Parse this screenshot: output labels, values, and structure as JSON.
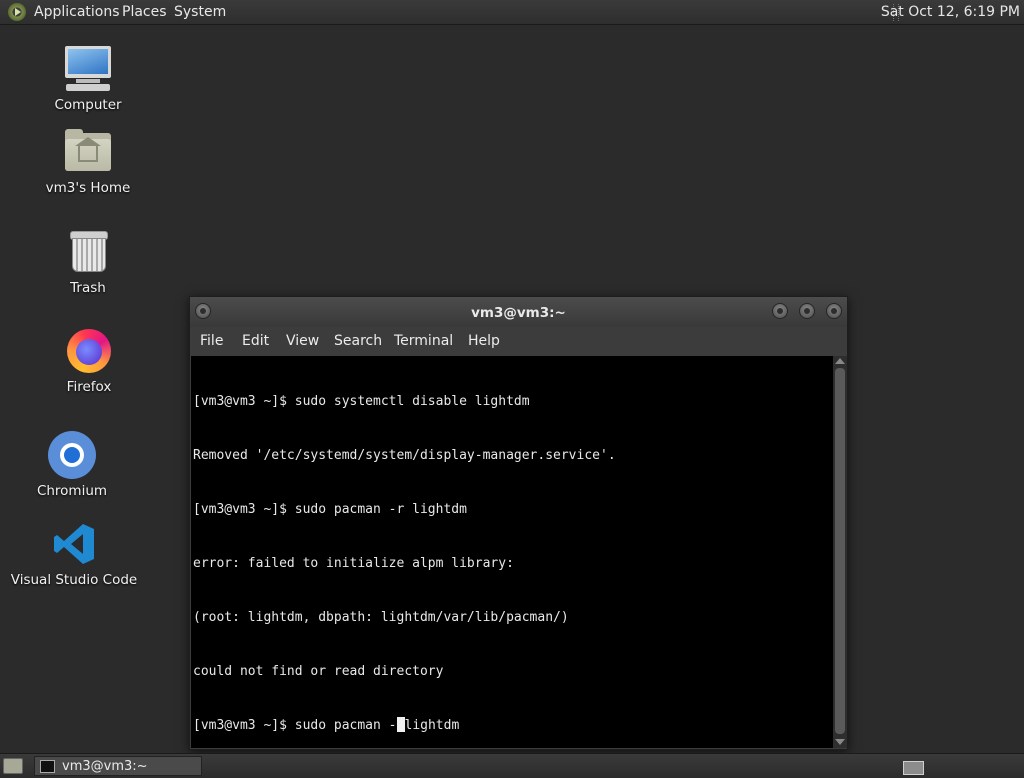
{
  "top_panel": {
    "menus": [
      "Applications",
      "Places",
      "System"
    ],
    "clock": "Sat Oct 12,  6:19 PM"
  },
  "desktop": {
    "icons": [
      {
        "label": "Computer",
        "icon": "computer-icon"
      },
      {
        "label": "vm3's Home",
        "icon": "home-folder-icon"
      },
      {
        "label": "Trash",
        "icon": "trash-icon"
      },
      {
        "label": "Firefox",
        "icon": "firefox-icon"
      },
      {
        "label": "Chromium",
        "icon": "chromium-icon"
      },
      {
        "label": "Visual Studio Code",
        "icon": "vscode-icon"
      }
    ]
  },
  "terminal": {
    "title": "vm3@vm3:~",
    "menu": [
      "File",
      "Edit",
      "View",
      "Search",
      "Terminal",
      "Help"
    ],
    "lines": [
      "[vm3@vm3 ~]$ sudo systemctl disable lightdm",
      "Removed '/etc/systemd/system/display-manager.service'.",
      "[vm3@vm3 ~]$ sudo pacman -r lightdm",
      "error: failed to initialize alpm library:",
      "(root: lightdm, dbpath: lightdm/var/lib/pacman/)",
      "could not find or read directory"
    ],
    "current_prompt": "[vm3@vm3 ~]$ sudo pacman -",
    "current_after_cursor": "lightdm"
  },
  "bottom_panel": {
    "task_label": "vm3@vm3:~"
  },
  "colors": {
    "desktop_bg": "#2b2b2b",
    "terminal_bg": "#000000",
    "terminal_fg": "#e8e8e8"
  }
}
